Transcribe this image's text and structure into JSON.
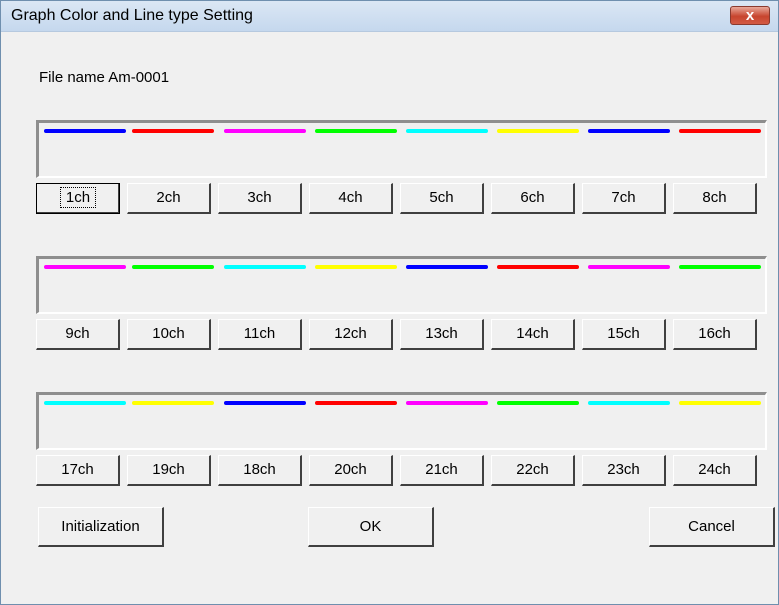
{
  "window": {
    "title": "Graph Color and Line type Setting",
    "close_label": "x"
  },
  "file_name": "File name Am-0001",
  "colors": {
    "blue": "#0000ff",
    "red": "#ff0000",
    "magenta": "#ff00ff",
    "green": "#00ff00",
    "cyan": "#00ffff",
    "yellow": "#ffff00"
  },
  "groups": [
    {
      "lines": [
        "blue",
        "red",
        "magenta",
        "green",
        "cyan",
        "yellow",
        "blue",
        "red"
      ],
      "channels": [
        "1ch",
        "2ch",
        "3ch",
        "4ch",
        "5ch",
        "6ch",
        "7ch",
        "8ch"
      ]
    },
    {
      "lines": [
        "magenta",
        "green",
        "cyan",
        "yellow",
        "blue",
        "red",
        "magenta",
        "green"
      ],
      "channels": [
        "9ch",
        "10ch",
        "11ch",
        "12ch",
        "13ch",
        "14ch",
        "15ch",
        "16ch"
      ]
    },
    {
      "lines": [
        "cyan",
        "yellow",
        "blue",
        "red",
        "magenta",
        "green",
        "cyan",
        "yellow"
      ],
      "channels": [
        "17ch",
        "19ch",
        "18ch",
        "20ch",
        "21ch",
        "22ch",
        "23ch",
        "24ch"
      ]
    }
  ],
  "buttons": {
    "initialization": "Initialization",
    "ok": "OK",
    "cancel": "Cancel"
  }
}
